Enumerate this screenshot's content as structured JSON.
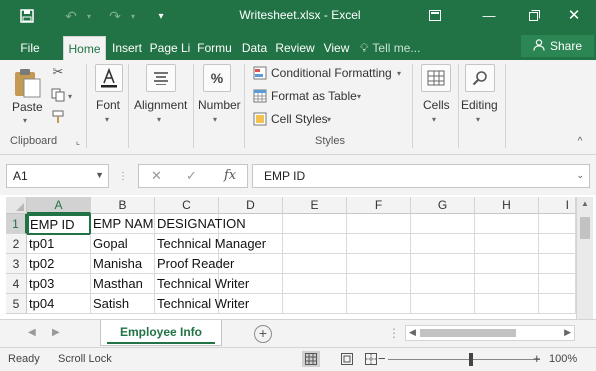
{
  "window": {
    "title": "Writesheet.xlsx - Excel"
  },
  "ribbon_tabs": [
    "File",
    "Home",
    "Insert",
    "Page Li",
    "Formu",
    "Data",
    "Review",
    "View"
  ],
  "tell_me": "Tell me...",
  "share_label": "Share",
  "clipboard": {
    "paste_label": "Paste",
    "group_label": "Clipboard"
  },
  "font_label": "Font",
  "alignment_label": "Alignment",
  "number_label": "Number",
  "styles": {
    "conditional_formatting": "Conditional Formatting",
    "format_as_table": "Format as Table",
    "cell_styles": "Cell Styles",
    "group_label": "Styles"
  },
  "cells_label": "Cells",
  "editing_label": "Editing",
  "formula_bar": {
    "name_box": "A1",
    "fx": "fx",
    "content": "EMP ID"
  },
  "columns": [
    "A",
    "B",
    "C",
    "D",
    "E",
    "F",
    "G",
    "H",
    "I"
  ],
  "rows": [
    "1",
    "2",
    "3",
    "4",
    "5"
  ],
  "cells": [
    [
      "EMP ID",
      "EMP NAM",
      "DESIGNATION"
    ],
    [
      "tp01",
      "Gopal",
      "Technical Manager"
    ],
    [
      "tp02",
      "Manisha",
      "Proof Reader"
    ],
    [
      "tp03",
      "Masthan",
      "Technical Writer"
    ],
    [
      "tp04",
      "Satish",
      "Technical Writer"
    ]
  ],
  "sheet_tab": "Employee Info",
  "status": {
    "ready": "Ready",
    "scroll_lock": "Scroll Lock",
    "zoom": "100%"
  }
}
